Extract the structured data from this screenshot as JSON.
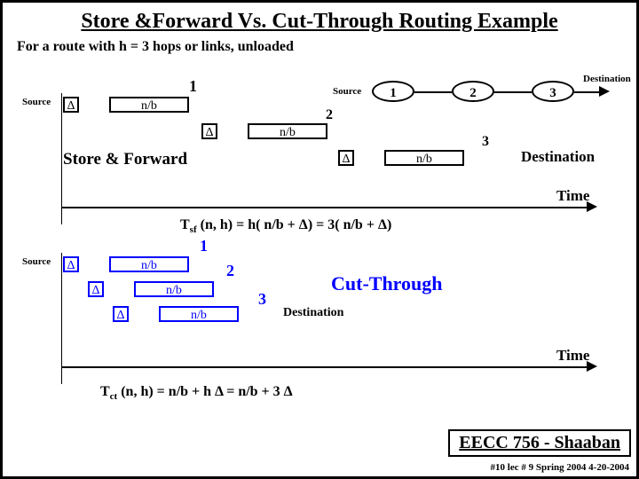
{
  "title": "Store &Forward Vs.  Cut-Through Routing Example",
  "subtitle": "For a route with h = 3 hops or links, unloaded",
  "labels": {
    "source": "Source",
    "destination": "Destination",
    "delta": "Δ",
    "nb": "n/b",
    "time": "Time",
    "store_forward": "Store & Forward",
    "cut_through": "Cut-Through",
    "one": "1",
    "two": "2",
    "three": "3"
  },
  "formulas": {
    "sf": "T",
    "sf_sub": "sf",
    "sf_rest": " (n,  h)  =  h( n/b + Δ)  = 3( n/b + Δ)",
    "ct": "T",
    "ct_sub": "ct",
    "ct_rest": " (n,  h)  =  n/b  + h Δ  = n/b  + 3 Δ"
  },
  "footer": {
    "course": "EECC 756 - Shaaban",
    "info": "#10  lec # 9    Spring 2004   4-20-2004"
  }
}
